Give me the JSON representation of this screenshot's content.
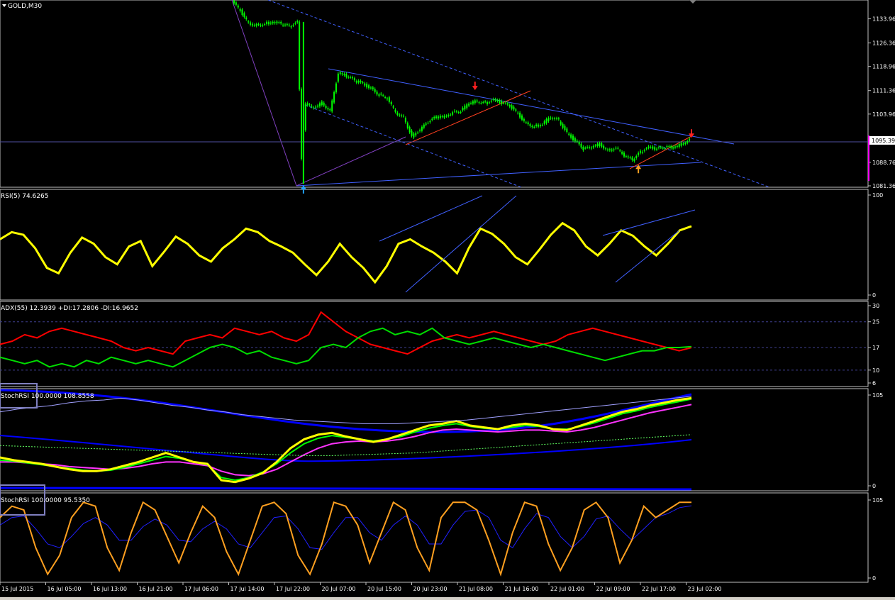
{
  "window": {
    "symbol_label": "GOLD,M30"
  },
  "colors": {
    "background": "#000000",
    "frame": "#c0c0c0",
    "candle": "#00ff00",
    "rsi": "#ffff00",
    "adx_plus": "#00dd00",
    "adx_minus": "#ff0000",
    "stoch_k": "#ffff00",
    "stoch_d": "#00ff00",
    "stoch_ma": "#ff33ff",
    "band": "#0000ff",
    "orange": "#ffa020",
    "trend": "#4060ff",
    "price_tag": "#ff00ff"
  },
  "chart_data": [
    {
      "type": "candlestick",
      "title": "GOLD,M30",
      "price_ticks": [
        "1133.96",
        "1126.36",
        "1118.96",
        "1111.36",
        "1103.96",
        "1095.39",
        "1088.76",
        "1081.36"
      ],
      "current_price": "1095.39",
      "ylim": [
        1081.36,
        1139.0
      ],
      "close_path": [
        [
          0,
          1139.5
        ],
        [
          1,
          1136.5
        ],
        [
          2,
          1132.5
        ],
        [
          3,
          1132.0
        ],
        [
          4,
          1132.5
        ],
        [
          5,
          1133.0
        ],
        [
          6,
          1132.5
        ],
        [
          7,
          1131.5
        ],
        [
          8,
          1133.0
        ],
        [
          8.5,
          1090.0
        ],
        [
          9,
          1107.0
        ],
        [
          10,
          1106.0
        ],
        [
          11,
          1107.5
        ],
        [
          12,
          1105.0
        ],
        [
          13,
          1117.0
        ],
        [
          14,
          1116.0
        ],
        [
          15,
          1114.5
        ],
        [
          16,
          1113.5
        ],
        [
          17,
          1112.0
        ],
        [
          18,
          1110.0
        ],
        [
          19,
          1109.0
        ],
        [
          20,
          1104.5
        ],
        [
          21,
          1103.0
        ],
        [
          22,
          1097.0
        ],
        [
          23,
          1099.0
        ],
        [
          24,
          1101.5
        ],
        [
          25,
          1103.0
        ],
        [
          26,
          1103.0
        ],
        [
          27,
          1104.5
        ],
        [
          28,
          1105.0
        ],
        [
          29,
          1107.5
        ],
        [
          30,
          1108.0
        ],
        [
          31,
          1107.5
        ],
        [
          32,
          1108.5
        ],
        [
          33,
          1107.5
        ],
        [
          34,
          1106.5
        ],
        [
          35,
          1104.0
        ],
        [
          36,
          1101.0
        ],
        [
          37,
          1100.0
        ],
        [
          38,
          1101.0
        ],
        [
          39,
          1103.0
        ],
        [
          40,
          1102.0
        ],
        [
          41,
          1098.0
        ],
        [
          42,
          1095.5
        ],
        [
          43,
          1093.0
        ],
        [
          44,
          1093.5
        ],
        [
          45,
          1094.5
        ],
        [
          46,
          1092.5
        ],
        [
          47,
          1093.5
        ],
        [
          48,
          1091.0
        ],
        [
          49,
          1089.5
        ],
        [
          50,
          1092.0
        ],
        [
          51,
          1093.5
        ],
        [
          52,
          1093.0
        ],
        [
          53,
          1093.5
        ],
        [
          54,
          1093.5
        ],
        [
          55,
          1094.5
        ],
        [
          56,
          1096.0
        ]
      ],
      "signals": [
        {
          "type": "sell-arrow",
          "x": 29.5,
          "y": 1111.5
        },
        {
          "type": "buy-arrow",
          "x": 8.5,
          "y": 1081.6
        },
        {
          "type": "sell-arrow",
          "x": 56,
          "y": 1096.5
        },
        {
          "type": "buy-arrow",
          "x": 49.5,
          "y": 1088.0
        }
      ]
    },
    {
      "type": "line",
      "title": "RSI(5) 74.6265",
      "ylim": [
        0,
        100
      ],
      "axis_ticks": [
        "100",
        "0"
      ],
      "series": [
        {
          "name": "RSI(5)",
          "values": [
            60,
            68,
            65,
            50,
            28,
            22,
            45,
            62,
            55,
            40,
            32,
            52,
            58,
            30,
            46,
            63,
            55,
            42,
            35,
            50,
            60,
            72,
            68,
            58,
            52,
            45,
            32,
            20,
            35,
            55,
            40,
            28,
            12,
            30,
            55,
            60,
            52,
            45,
            35,
            22,
            50,
            72,
            66,
            55,
            40,
            32,
            48,
            65,
            78,
            70,
            52,
            42,
            55,
            70,
            64,
            52,
            42,
            55,
            70,
            74.6
          ]
        }
      ]
    },
    {
      "type": "line",
      "title": "ADX(55) 12.3939 +DI:17.2806 -DI:16.9652",
      "ylim": [
        6,
        30
      ],
      "axis_ticks": [
        "30",
        "25",
        "17",
        "10",
        "6"
      ],
      "levels": [
        25,
        17,
        10
      ],
      "series": [
        {
          "name": "+DI",
          "values": [
            14,
            13,
            12,
            13,
            11,
            12,
            11,
            13,
            12,
            14,
            13,
            12,
            13,
            12,
            11,
            13,
            15,
            17,
            18,
            17,
            15,
            16,
            14,
            13,
            12,
            13,
            17,
            18,
            17,
            20,
            22,
            23,
            21,
            22,
            21,
            23,
            20,
            19,
            18,
            19,
            20,
            19,
            18,
            17,
            18,
            17,
            16,
            15,
            14,
            13,
            14,
            15,
            16,
            16,
            17,
            17,
            17.3
          ]
        },
        {
          "name": "-DI",
          "values": [
            18,
            19,
            21,
            20,
            22,
            23,
            22,
            21,
            20,
            19,
            17,
            16,
            17,
            16,
            15,
            19,
            20,
            21,
            20,
            23,
            22,
            21,
            22,
            20,
            19,
            21,
            28,
            25,
            22,
            20,
            18,
            17,
            16,
            15,
            17,
            19,
            20,
            21,
            20,
            21,
            22,
            21,
            20,
            19,
            18,
            19,
            21,
            22,
            23,
            22,
            21,
            20,
            19,
            18,
            17,
            16,
            16.97
          ]
        }
      ]
    },
    {
      "type": "line",
      "title": "StochRSI 100.0000 108.8558",
      "ylim": [
        0,
        105
      ],
      "axis_ticks": [
        "105",
        "0"
      ],
      "series": [
        {
          "name": "StochRSI",
          "values": [
            35,
            32,
            30,
            28,
            25,
            22,
            20,
            20,
            22,
            26,
            30,
            35,
            40,
            35,
            30,
            28,
            10,
            8,
            12,
            18,
            30,
            45,
            55,
            60,
            62,
            58,
            55,
            52,
            55,
            60,
            65,
            70,
            72,
            75,
            70,
            68,
            66,
            70,
            72,
            70,
            66,
            65,
            70,
            75,
            80,
            85,
            88,
            92,
            95,
            98,
            100
          ]
        },
        {
          "name": "%D",
          "values": [
            32,
            31,
            29,
            27,
            25,
            23,
            21,
            20,
            21,
            24,
            28,
            32,
            36,
            34,
            30,
            27,
            13,
            10,
            13,
            19,
            28,
            40,
            50,
            56,
            59,
            57,
            55,
            53,
            55,
            58,
            63,
            67,
            70,
            72,
            69,
            67,
            66,
            68,
            70,
            69,
            66,
            66,
            69,
            73,
            78,
            83,
            86,
            90,
            93,
            96,
            99
          ]
        },
        {
          "name": "MA",
          "values": [
            30,
            30,
            29,
            28,
            27,
            25,
            24,
            23,
            22,
            23,
            25,
            28,
            30,
            30,
            28,
            26,
            20,
            16,
            15,
            17,
            22,
            30,
            38,
            45,
            50,
            52,
            53,
            52,
            53,
            55,
            58,
            62,
            65,
            66,
            65,
            64,
            63,
            64,
            65,
            65,
            64,
            63,
            65,
            68,
            72,
            76,
            80,
            84,
            87,
            90,
            93
          ]
        },
        {
          "name": "Band upper",
          "values": [
            85,
            88,
            90,
            92,
            95,
            97,
            98,
            100,
            98,
            95,
            92,
            90,
            87,
            85,
            82,
            80,
            78,
            76,
            75,
            74,
            73,
            72,
            72,
            72,
            73,
            74,
            75,
            76,
            78,
            80,
            82,
            84,
            86,
            88,
            90,
            92,
            94,
            96,
            98,
            100,
            102
          ]
        },
        {
          "name": "Band lower",
          "values": [
            48,
            47,
            46,
            45,
            44,
            43,
            42,
            41,
            40,
            39,
            38,
            37,
            37,
            38,
            39,
            40,
            42,
            44,
            46,
            48,
            50,
            52,
            54,
            56,
            58,
            60
          ]
        }
      ]
    },
    {
      "type": "line",
      "title": "StochRSI 100.0000 95.5350",
      "ylim": [
        0,
        105
      ],
      "axis_ticks": [
        "105",
        "0"
      ],
      "series": [
        {
          "name": "StochRSI",
          "values": [
            80,
            95,
            90,
            40,
            5,
            30,
            80,
            100,
            95,
            40,
            10,
            60,
            100,
            90,
            55,
            20,
            60,
            95,
            80,
            35,
            5,
            50,
            95,
            100,
            85,
            30,
            5,
            45,
            100,
            95,
            70,
            20,
            60,
            100,
            90,
            40,
            10,
            80,
            100,
            100,
            90,
            50,
            5,
            60,
            100,
            95,
            45,
            10,
            40,
            90,
            100,
            80,
            20,
            50,
            95,
            80,
            90,
            100,
            100
          ]
        },
        {
          "name": "Signal",
          "values": [
            70,
            80,
            82,
            65,
            45,
            40,
            55,
            72,
            80,
            70,
            50,
            50,
            68,
            78,
            70,
            50,
            48,
            65,
            75,
            65,
            45,
            40,
            60,
            80,
            82,
            65,
            40,
            38,
            60,
            80,
            80,
            60,
            50,
            70,
            82,
            70,
            45,
            45,
            70,
            88,
            90,
            80,
            50,
            40,
            65,
            85,
            80,
            55,
            40,
            55,
            78,
            82,
            65,
            50,
            65,
            80,
            85,
            93,
            95.5
          ]
        }
      ]
    }
  ],
  "time_axis": {
    "labels": [
      "15 Jul 2015",
      "16 Jul 05:00",
      "16 Jul 13:00",
      "16 Jul 21:00",
      "17 Jul 06:00",
      "17 Jul 14:00",
      "17 Jul 22:00",
      "20 Jul 07:00",
      "20 Jul 15:00",
      "20 Jul 23:00",
      "21 Jul 08:00",
      "21 Jul 16:00",
      "22 Jul 01:00",
      "22 Jul 09:00",
      "22 Jul 17:00",
      "23 Jul 02:00"
    ]
  }
}
